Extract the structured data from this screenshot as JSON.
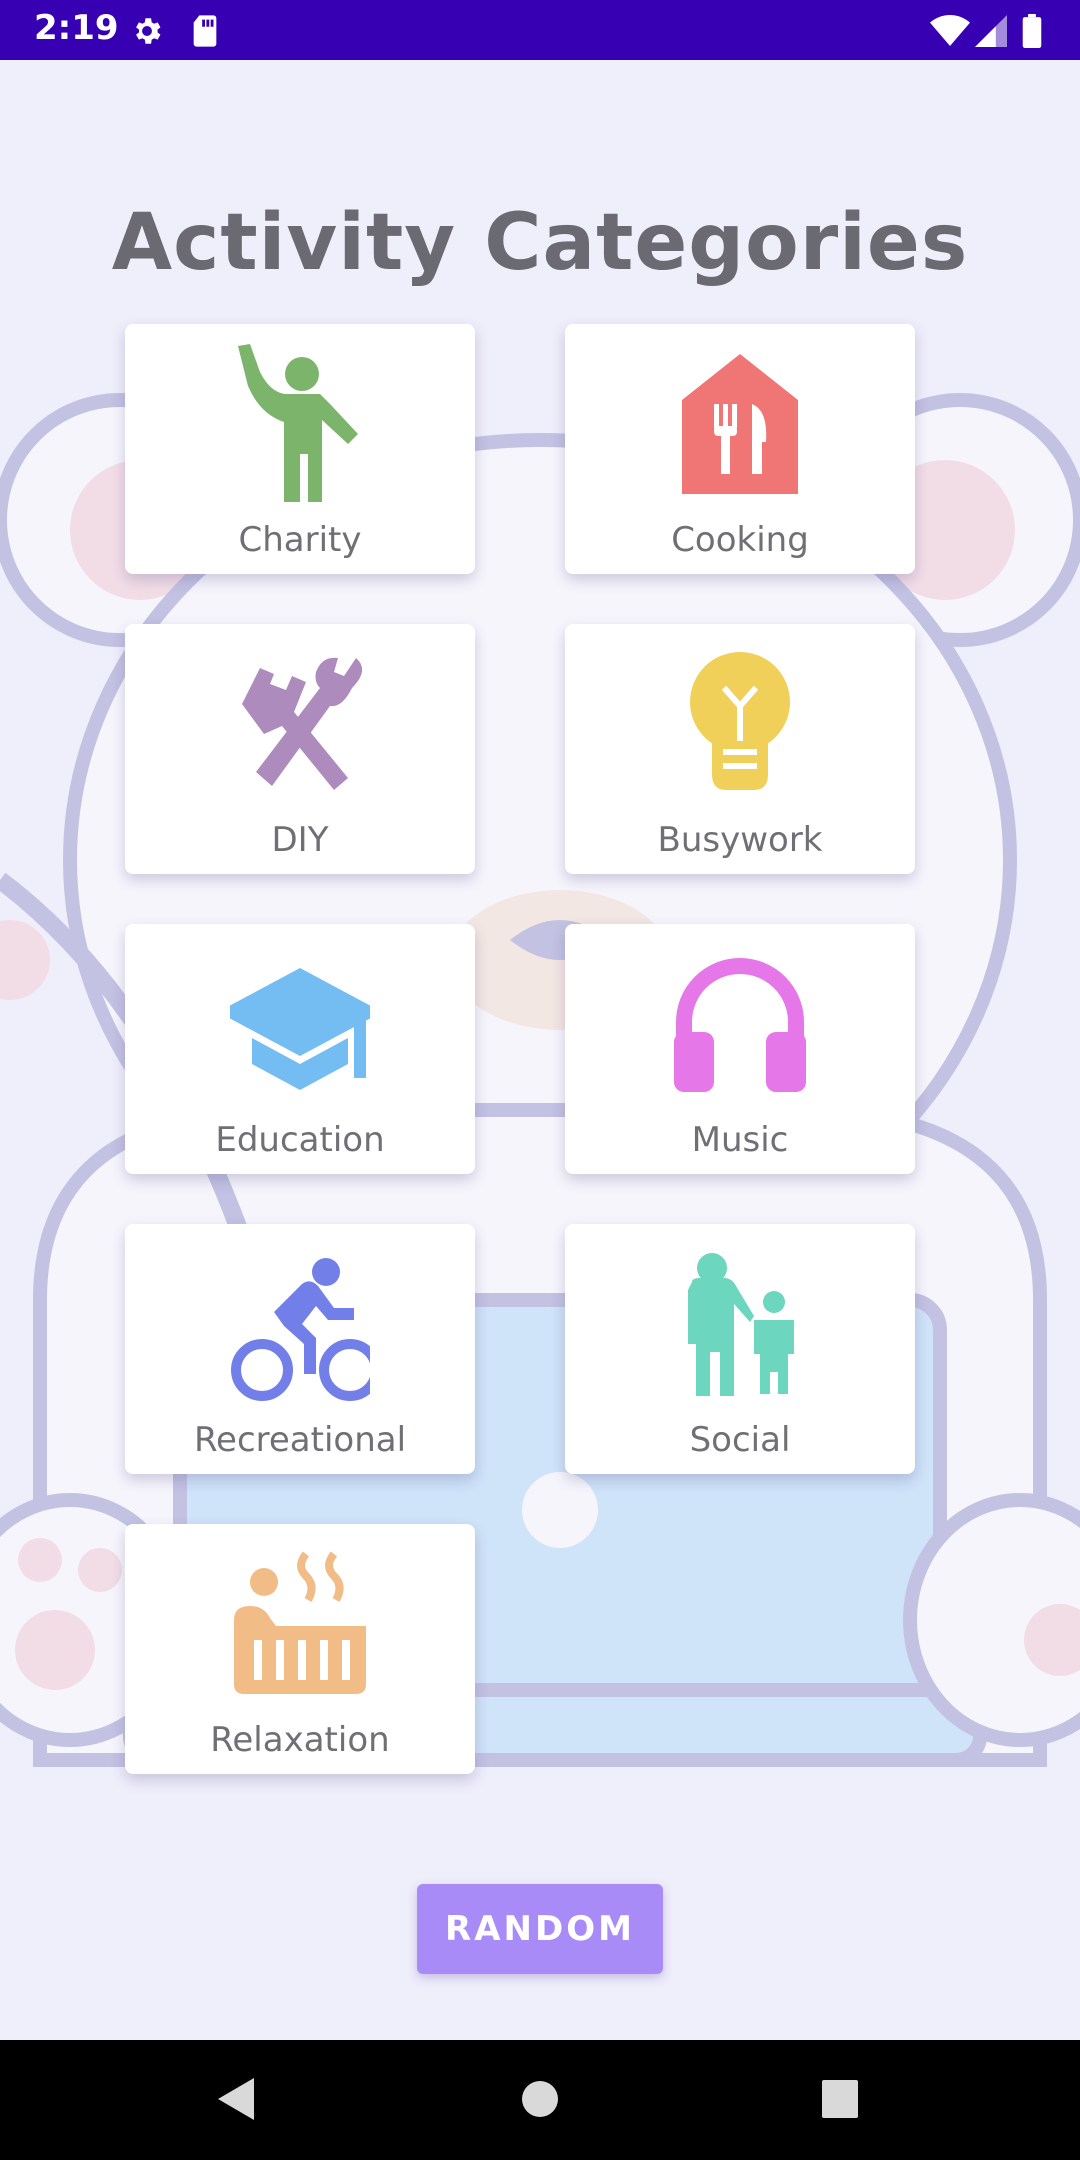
{
  "status_bar": {
    "time": "2:19",
    "icons": [
      "settings-icon",
      "sd-card-icon",
      "wifi-icon",
      "signal-icon",
      "battery-icon"
    ],
    "background_color": "#3700b3"
  },
  "page": {
    "title": "Activity Categories",
    "background_color": "#efeefb"
  },
  "categories": [
    {
      "label": "Charity",
      "icon": "person-waving-icon",
      "color": "#7db46c"
    },
    {
      "label": "Cooking",
      "icon": "restaurant-house-icon",
      "color": "#f07575"
    },
    {
      "label": "DIY",
      "icon": "tools-icon",
      "color": "#ad8bbd"
    },
    {
      "label": "Busywork",
      "icon": "lightbulb-icon",
      "color": "#f0d058"
    },
    {
      "label": "Education",
      "icon": "graduation-cap-icon",
      "color": "#74bdf2"
    },
    {
      "label": "Music",
      "icon": "headphones-icon",
      "color": "#e577e8"
    },
    {
      "label": "Recreational",
      "icon": "bicycle-icon",
      "color": "#737fe8"
    },
    {
      "label": "Social",
      "icon": "family-icon",
      "color": "#6dd6be"
    },
    {
      "label": "Relaxation",
      "icon": "hot-tub-icon",
      "color": "#f2bc86"
    }
  ],
  "random_button": {
    "label": "RANDOM",
    "color": "#a98bf8"
  },
  "nav_bar": {
    "buttons": [
      "back-icon",
      "home-icon",
      "recents-icon"
    ]
  }
}
